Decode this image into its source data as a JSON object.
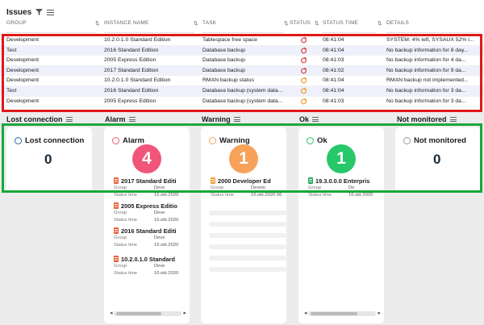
{
  "issues": {
    "title": "Issues",
    "columns": {
      "group": "GROUP",
      "instance": "INSTANCE NAME",
      "task": "TASK",
      "status": "STATUS",
      "time": "STATUS TIME",
      "details": "DETAILS"
    },
    "rows": [
      {
        "group": "Development",
        "instance": "10.2.0.1.0 Standard Edition",
        "task": "Tablespace free space",
        "status": "alarm",
        "time": "08:41:04",
        "details": "SYSTEM: 4% left, SYSAUX 52% l..."
      },
      {
        "group": "Test",
        "instance": "2016 Standard Edition",
        "task": "Database backup",
        "status": "alarm",
        "time": "08:41:04",
        "details": "No backup information for 8 day..."
      },
      {
        "group": "Development",
        "instance": "2005 Express Edition",
        "task": "Database backup",
        "status": "alarm",
        "time": "08:41:03",
        "details": "No backup information for 4 da..."
      },
      {
        "group": "Development",
        "instance": "2017 Standard Edition",
        "task": "Database backup",
        "status": "alarm",
        "time": "08:41:02",
        "details": "No backup information for 9 da..."
      },
      {
        "group": "Development",
        "instance": "10.2.0.1.0 Standard Edition",
        "task": "RMAN backup status",
        "status": "warning",
        "time": "08:41:04",
        "details": "RMAN backup not implemented..."
      },
      {
        "group": "Test",
        "instance": "2016 Standard Edition",
        "task": "Database backup (system data...",
        "status": "warning",
        "time": "08:41:04",
        "details": "No backup information for 3 da..."
      },
      {
        "group": "Development",
        "instance": "2005 Express Edition",
        "task": "Database backup (system data...",
        "status": "warning",
        "time": "08:41:03",
        "details": "No backup information for 3 da..."
      }
    ]
  },
  "board": {
    "columns": [
      {
        "header": "Lost connection",
        "title": "Lost connection",
        "count": "0",
        "color": "#1f6fb5"
      },
      {
        "header": "Alarm",
        "title": "Alarm",
        "count": "4",
        "color": "#f0567a"
      },
      {
        "header": "Warning",
        "title": "Warning",
        "count": "1",
        "color": "#f7a25a"
      },
      {
        "header": "Ok",
        "title": "Ok",
        "count": "1",
        "color": "#27c86a"
      },
      {
        "header": "Not monitored",
        "title": "Not monitored",
        "count": "0",
        "color": "#9a9a9a"
      }
    ],
    "alarm_entries": [
      {
        "title": "2017 Standard Editi",
        "group_label": "Group",
        "group_value": "Deve",
        "time_label": "Status time",
        "time_value": "16.okt.2020"
      },
      {
        "title": "2005 Express Editio",
        "group_label": "Group",
        "group_value": "Deve",
        "time_label": "Status time",
        "time_value": "16.okt.2020"
      },
      {
        "title": "2016 Standard Editi",
        "group_label": "Group",
        "group_value": "Deve",
        "time_label": "Status time",
        "time_value": "16.okt.2020"
      },
      {
        "title": "10.2.0.1.0 Standard",
        "group_label": "Group",
        "group_value": "Deve",
        "time_label": "Status time",
        "time_value": "16.okt.2020"
      }
    ],
    "warning_entry": {
      "title": "2000 Developer Ed",
      "group_label": "Group",
      "group_value": "Develo",
      "time_label": "Status time",
      "time_value": "16.okt.2020 06"
    },
    "ok_entry": {
      "title": "19.3.0.0.0 Enterpris",
      "group_label": "Group",
      "group_value": "De",
      "time_label": "Status time",
      "time_value": "16.okt.2020"
    }
  }
}
